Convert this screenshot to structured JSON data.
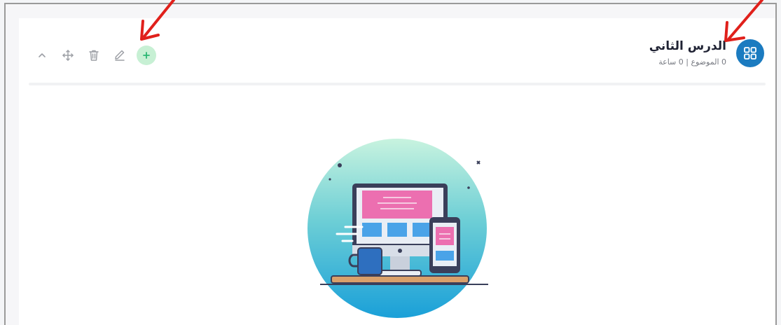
{
  "lesson": {
    "title": "الدرس الثاني",
    "meta": "0 الموضوع | 0 ساعة",
    "avatar_icon": "grid-icon"
  },
  "toolbar": {
    "icons": [
      "chevron-up-icon",
      "move-icon",
      "trash-icon",
      "edit-icon",
      "plus-icon"
    ]
  },
  "colors": {
    "accent": "#1b7bc0",
    "add_button_bg": "#c7f0d4",
    "add_button_fg": "#2bb673",
    "annotation_arrow": "#e0201b"
  },
  "illustration": "devices-empty-state"
}
